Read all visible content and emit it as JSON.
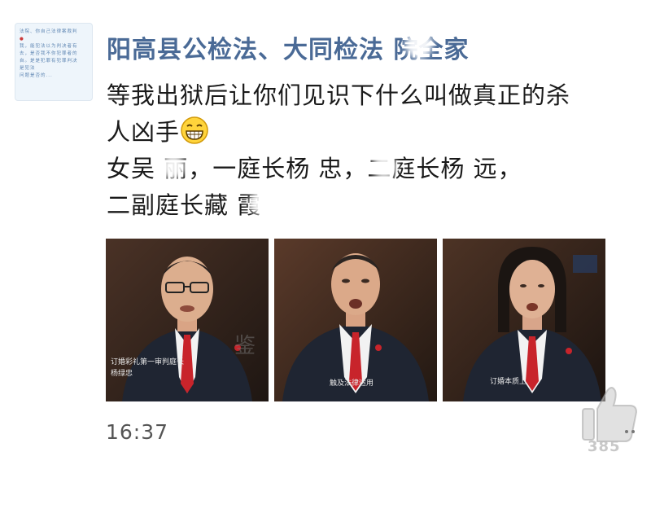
{
  "author": {
    "name": "阳高县公检法、大同检法 院全家"
  },
  "avatar": {
    "lines": [
      "法院、你自己法律案裁判",
      "我，能犯法以为判决者有",
      "去，是否我不你犯罪者的",
      "自。是是犯罪有犯罪判决",
      "是犯法",
      "问题是否的..."
    ]
  },
  "post": {
    "lines": [
      "等我出狱后让你们见识下什么叫做真正的杀",
      "人凶手",
      "女吴  丽，一庭长杨  忠，二庭长杨  远，",
      "二副庭长藏  霞"
    ],
    "emoji": "grinning-face-emoji"
  },
  "photos": [
    {
      "caption_1": "订婚彩礼第一审判庭长",
      "caption_2": "杨绿忠",
      "watermark": "鉴"
    },
    {
      "caption_1": "触及法律适用"
    },
    {
      "caption_1": "订婚本质上"
    }
  ],
  "timestamp": "16:37",
  "like": {
    "count": "385",
    "icon": "thumbs-up-icon"
  },
  "colors": {
    "author": "#4a6a96",
    "suit": "#1f2532",
    "tie": "#c8242b",
    "background_photo": "#3a2a22"
  }
}
